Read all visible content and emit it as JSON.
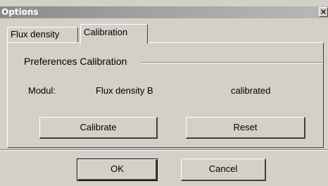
{
  "window": {
    "title": "Options",
    "close_glyph": "✕"
  },
  "tabs": [
    {
      "label": "Flux density",
      "selected": false
    },
    {
      "label": "Calibration",
      "selected": true
    }
  ],
  "group": {
    "title": "Preferences Calibration"
  },
  "row": {
    "modul_label": "Modul:",
    "quantity": "Flux density B",
    "status": "calibrated"
  },
  "buttons": {
    "calibrate": "Calibrate",
    "reset": "Reset",
    "ok": "OK",
    "cancel": "Cancel"
  },
  "colors": {
    "face": "#d4d0c8",
    "title_gradient_start": "#8a8a8a",
    "title_gradient_end": "#b8b8b8"
  }
}
